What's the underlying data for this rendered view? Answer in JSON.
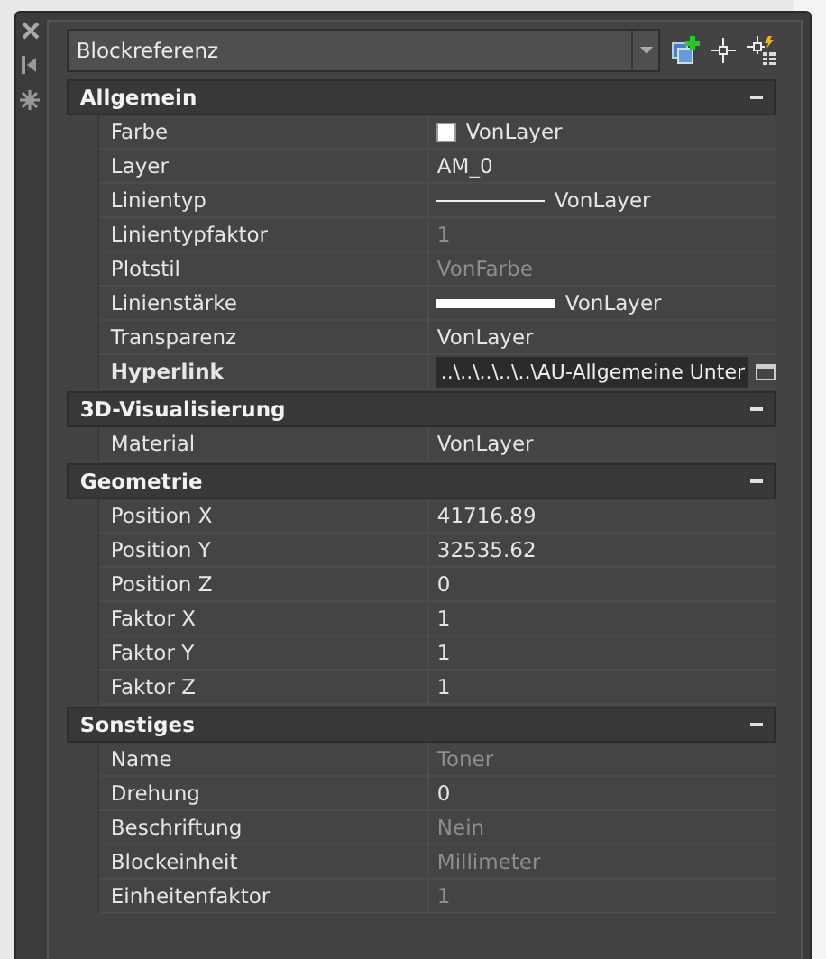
{
  "selector": {
    "value": "Blockreferenz"
  },
  "sections": [
    {
      "title": "Allgemein",
      "expanded": true,
      "rows": [
        {
          "label": "Farbe",
          "value": "VonLayer",
          "kind": "color",
          "color": "#ffffff",
          "disabled": false
        },
        {
          "label": "Layer",
          "value": "AM_0",
          "kind": "text",
          "disabled": false
        },
        {
          "label": "Linientyp",
          "value": "VonLayer",
          "kind": "linetype",
          "disabled": false
        },
        {
          "label": "Linientypfaktor",
          "value": "1",
          "kind": "text",
          "disabled": true
        },
        {
          "label": "Plotstil",
          "value": "VonFarbe",
          "kind": "text",
          "disabled": true
        },
        {
          "label": "Linienstärke",
          "value": "VonLayer",
          "kind": "lineweight",
          "disabled": false
        },
        {
          "label": "Transparenz",
          "value": "VonLayer",
          "kind": "text",
          "disabled": false
        },
        {
          "label": "Hyperlink",
          "value": "..\\..\\..\\..\\..\\AU-Allgemeine Unter",
          "kind": "link",
          "disabled": false
        }
      ]
    },
    {
      "title": "3D-Visualisierung",
      "expanded": true,
      "rows": [
        {
          "label": "Material",
          "value": "VonLayer",
          "kind": "text",
          "disabled": false
        }
      ]
    },
    {
      "title": "Geometrie",
      "expanded": true,
      "rows": [
        {
          "label": "Position X",
          "value": "41716.89",
          "kind": "text",
          "disabled": false
        },
        {
          "label": "Position Y",
          "value": "32535.62",
          "kind": "text",
          "disabled": false
        },
        {
          "label": "Position Z",
          "value": "0",
          "kind": "text",
          "disabled": false
        },
        {
          "label": "Faktor X",
          "value": "1",
          "kind": "text",
          "disabled": false
        },
        {
          "label": "Faktor Y",
          "value": "1",
          "kind": "text",
          "disabled": false
        },
        {
          "label": "Faktor Z",
          "value": "1",
          "kind": "text",
          "disabled": false
        }
      ]
    },
    {
      "title": "Sonstiges",
      "expanded": true,
      "rows": [
        {
          "label": "Name",
          "value": "Toner",
          "kind": "text",
          "disabled": true
        },
        {
          "label": "Drehung",
          "value": "0",
          "kind": "text",
          "disabled": false
        },
        {
          "label": "Beschriftung",
          "value": "Nein",
          "kind": "text",
          "disabled": true
        },
        {
          "label": "Blockeinheit",
          "value": "Millimeter",
          "kind": "text",
          "disabled": true
        },
        {
          "label": "Einheitenfaktor",
          "value": "1",
          "kind": "text",
          "disabled": true
        }
      ]
    }
  ]
}
